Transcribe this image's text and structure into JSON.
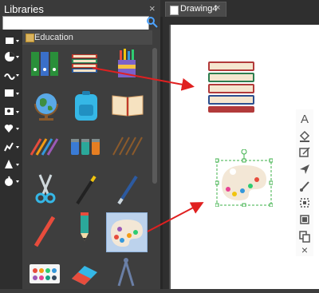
{
  "libraries_panel": {
    "title": "Libraries",
    "close_glyph": "×",
    "search": {
      "value": "",
      "placeholder": ""
    },
    "category": {
      "label": "Education"
    }
  },
  "document_tab": {
    "label": "Drawing4",
    "close_glyph": "×"
  },
  "sidebar_icons": [
    "shape-icon",
    "pie-chart-icon",
    "wave-icon",
    "image-icon",
    "picture-icon",
    "heart-icon",
    "chart-icon",
    "pyramid-icon",
    "apple-icon"
  ],
  "library_items": [
    "binders-icon",
    "stacked-books-icon",
    "pencil-cup-icon",
    "globe-icon",
    "backpack-icon",
    "open-book-icon",
    "colored-pencils-icon",
    "paint-jars-icon",
    "paintbrushes-icon",
    "scissors-icon",
    "fountain-pen-icon",
    "blue-pen-icon",
    "red-pencil-icon",
    "pencil-icon",
    "palette-icon",
    "watercolor-set-icon",
    "eraser-icon",
    "compass-icon"
  ],
  "canvas_toolbar": [
    "text-tool-icon",
    "fill-tool-icon",
    "line-style-icon",
    "arrow-tool-icon",
    "brush-tool-icon",
    "fit-tool-icon",
    "group-tool-icon",
    "copy-tool-icon",
    "delete-tool-icon"
  ],
  "canvas_toolbar_text": {
    "text_tool": "A",
    "delete_tool": "×"
  },
  "colors": {
    "arrow": "#e02020",
    "selection": "#3cb04a",
    "panel_bg": "#3a3a3a",
    "canvas_bg": "#ffffff"
  }
}
